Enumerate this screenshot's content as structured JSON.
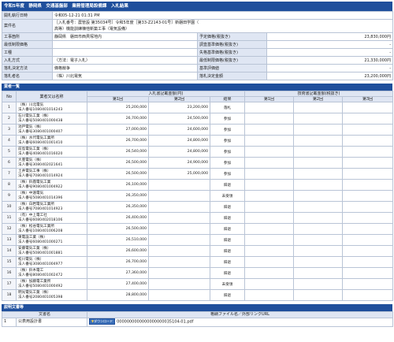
{
  "header": {
    "title": "令和5年度　静岡県　交通基盤部　業務管理局設備課　入札結果"
  },
  "info": {
    "rows": [
      {
        "label": "開札執行日時",
        "value": "令和05-12-21 01:31 PM",
        "r_label": "",
        "r_value": ""
      },
      {
        "label": "案件名",
        "value": "［入札番号：農管設 第35034号］令和5年度［第33-Z2143-01号］新磐田学園（",
        "value2": "高等）機能訓練棟他新築工事（電気設備）",
        "r_label": "",
        "r_value": ""
      },
      {
        "label": "工事箇所",
        "value": "静岡県　磐田市西貝塚地内",
        "r_label": "予定価格(税抜き)",
        "r_value": "23,830,000円"
      },
      {
        "label": "最低制限価格",
        "value": "",
        "r_label": "調査基準価格(税抜き)",
        "r_value": "-"
      },
      {
        "label": "工種",
        "value": "",
        "r_label": "失格基準価格(税抜き)",
        "r_value": "-"
      },
      {
        "label": "入札方式",
        "value": "（方法：電子入札）",
        "r_label": "最低制限価格(税抜き)",
        "r_value": "21,330,000円"
      },
      {
        "label": "落札決定方法",
        "value": "価格競争",
        "r_label": "基準評価値",
        "r_value": "-"
      },
      {
        "label": "落札者名",
        "value": "（株）川北電気",
        "r_label": "落札決定金額",
        "r_value": "23,200,000円"
      }
    ]
  },
  "bidders": {
    "section_title": "業者一覧",
    "headers": {
      "no": "No",
      "name": "業者又は名称",
      "bid_group": "入札書記載金額(円)",
      "eval_group": "技術書記載金額(税抜き)",
      "r1": "第1回",
      "r2": "第2回",
      "result": "結果",
      "e1": "第1回",
      "e2": "第2回",
      "e3": "第3回"
    },
    "rows": [
      {
        "no": "1",
        "name": "（株）川北電気",
        "corp": "法人番号1080401014243",
        "r1": "25,200,000",
        "r2": "23,200,000",
        "result": "落札"
      },
      {
        "no": "2",
        "name": "石川電気工業（株）",
        "corp": "法人番号5080401000438",
        "r1": "26,700,000",
        "r2": "24,500,000",
        "result": "参加"
      },
      {
        "no": "3",
        "name": "池戸電気（株）",
        "corp": "法人番号3080401000407",
        "r1": "27,000,000",
        "r2": "24,600,000",
        "result": "参加"
      },
      {
        "no": "4",
        "name": "（株）水代電気工業所",
        "corp": "法人番号6080401001410",
        "r1": "26,700,000",
        "r2": "24,800,000",
        "result": "参加"
      },
      {
        "no": "5",
        "name": "前島電気工業（株）",
        "corp": "法人番号4080401016020",
        "r1": "26,540,000",
        "r2": "24,800,000",
        "result": "参加"
      },
      {
        "no": "6",
        "name": "大豊電気（株）",
        "corp": "法人番号3080402021641",
        "r1": "26,500,000",
        "r2": "24,900,000",
        "result": "参加"
      },
      {
        "no": "7",
        "name": "土井電気工事（株）",
        "corp": "法人番号7080401014924",
        "r1": "26,500,000",
        "r2": "25,000,000",
        "result": "参加"
      },
      {
        "no": "8",
        "name": "（株）鈴鹿電気工業",
        "corp": "法人番号9080401004922",
        "r1": "26,100,000",
        "r2": "",
        "result": "辞退"
      },
      {
        "no": "9",
        "name": "（株）中遠電気",
        "corp": "法人番号5080401014396",
        "r1": "26,350,000",
        "r2": "",
        "result": "未受領"
      },
      {
        "no": "10",
        "name": "（株）白岩電気工業所",
        "corp": "法人番号7080401014923",
        "r1": "26,350,000",
        "r2": "",
        "result": "辞退"
      },
      {
        "no": "11",
        "name": "（有）中上電工社",
        "corp": "法人番号6080402018106",
        "r1": "26,400,000",
        "r2": "",
        "result": "辞退"
      },
      {
        "no": "12",
        "name": "（株）松谷電気工業所",
        "corp": "法人番号1080401006208",
        "r1": "26,500,000",
        "r2": "",
        "result": "辞退"
      },
      {
        "no": "13",
        "name": "東電設工業（株）",
        "corp": "法人番号6080401000271",
        "r1": "26,510,000",
        "r2": "",
        "result": "辞退"
      },
      {
        "no": "14",
        "name": "安藤電気工業（株）",
        "corp": "法人番号5080401001881",
        "r1": "26,600,000",
        "r2": "",
        "result": "辞退"
      },
      {
        "no": "15",
        "name": "松川電気（株）",
        "corp": "法人番号3080401004977",
        "r1": "26,700,000",
        "r2": "",
        "result": "辞退"
      },
      {
        "no": "16",
        "name": "（株）鈴木電工",
        "corp": "法人番号8080401002472",
        "r1": "27,360,000",
        "r2": "",
        "result": "辞退"
      },
      {
        "no": "17",
        "name": "（株）加藤電工業所",
        "corp": "法人番号5080401000492",
        "r1": "27,400,000",
        "r2": "",
        "result": "未受領"
      },
      {
        "no": "18",
        "name": "明光電気工業（株）",
        "corp": "法人番号2080401005398",
        "r1": "28,800,000",
        "r2": "",
        "result": "辞退"
      }
    ]
  },
  "documents": {
    "section_title": "説明文書等",
    "headers": {
      "name": "文書名",
      "file": "格納ファイル名／外部リンクURL"
    },
    "rows": [
      {
        "no": "1",
        "name": "公表用設計書",
        "button": "ダウンロード",
        "file": "0000000000000000000035104-01.pdf"
      }
    ]
  }
}
